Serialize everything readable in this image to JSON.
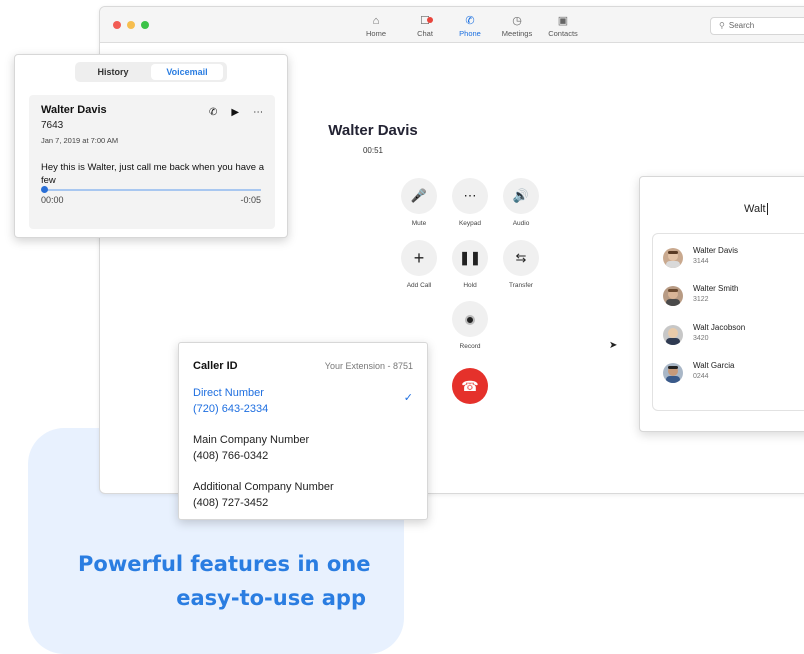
{
  "tagline": {
    "line1": "Powerful features in one",
    "line2": "easy-to-use app"
  },
  "colors": {
    "accent": "#2a7de1",
    "end_call": "#e5312b",
    "blob": "#e8f1fe"
  },
  "window": {
    "nav": [
      {
        "label": "Home",
        "icon": "home-icon"
      },
      {
        "label": "Chat",
        "icon": "chat-icon"
      },
      {
        "label": "Phone",
        "icon": "phone-icon",
        "active": true
      },
      {
        "label": "Meetings",
        "icon": "clock-icon"
      },
      {
        "label": "Contacts",
        "icon": "contacts-icon"
      }
    ],
    "search_placeholder": "Search"
  },
  "call": {
    "name": "Walter Davis",
    "duration": "00:51",
    "controls": {
      "mute": "Mute",
      "keypad": "Keypad",
      "audio": "Audio",
      "add_call": "Add Call",
      "hold": "Hold",
      "transfer": "Transfer",
      "record": "Record"
    }
  },
  "voicemail": {
    "tabs": {
      "history": "History",
      "voicemail": "Voicemail"
    },
    "caller": "Walter Davis",
    "ext": "7643",
    "date": "Jan 7, 2019 at 7:00 AM",
    "message": "Hey this is Walter, just call me back when you have a few",
    "time_elapsed": "00:00",
    "time_remaining": "-0:05",
    "progress": 0.0
  },
  "contacts": {
    "query": "Walt",
    "results": [
      {
        "name": "Walter Davis",
        "ext": "3144"
      },
      {
        "name": "Walter Smith",
        "ext": "3122"
      },
      {
        "name": "Walt Jacobson",
        "ext": "3420"
      },
      {
        "name": "Walt Garcia",
        "ext": "0244"
      }
    ]
  },
  "caller_id": {
    "title": "Caller ID",
    "extension": "Your Extension - 8751",
    "options": [
      {
        "label": "Direct Number",
        "number": "(720) 643-2334",
        "selected": true
      },
      {
        "label": "Main Company Number",
        "number": "(408) 766-0342"
      },
      {
        "label": "Additional Company Number",
        "number": "(408) 727-3452"
      }
    ]
  }
}
